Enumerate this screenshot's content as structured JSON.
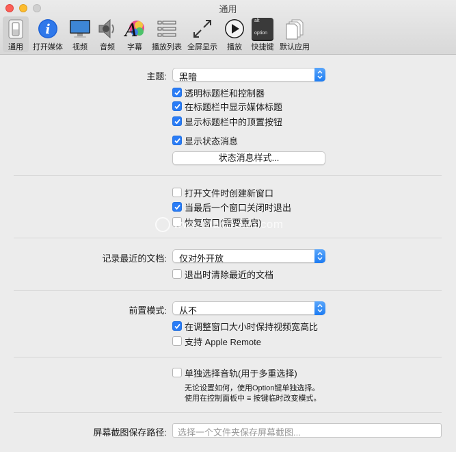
{
  "window": {
    "title": "通用"
  },
  "toolbar": {
    "items": [
      {
        "label": "通用"
      },
      {
        "label": "打开媒体"
      },
      {
        "label": "视频"
      },
      {
        "label": "音频"
      },
      {
        "label": "字幕"
      },
      {
        "label": "播放列表"
      },
      {
        "label": "全屏显示"
      },
      {
        "label": "播放"
      },
      {
        "label": "快捷键"
      },
      {
        "label": "默认应用"
      }
    ],
    "shortcut_keys": {
      "top": "alt",
      "bottom": "option"
    }
  },
  "theme": {
    "label": "主题:",
    "selected": "黑暗",
    "options": [
      {
        "label": "透明标题栏和控制器",
        "checked": true
      },
      {
        "label": "在标题栏中显示媒体标题",
        "checked": true
      },
      {
        "label": "显示标题栏中的顶置按钮",
        "checked": true
      },
      {
        "label": "显示状态消息",
        "checked": true
      }
    ],
    "status_style_button": "状态消息样式..."
  },
  "window_options": [
    {
      "label": "打开文件时创建新窗口",
      "checked": false
    },
    {
      "label": "当最后一个窗口关闭时退出",
      "checked": true
    },
    {
      "label": "恢复窗口(需要重启)",
      "checked": false
    }
  ],
  "recent": {
    "label": "记录最近的文档:",
    "selected": "仅对外开放",
    "clear_on_quit": {
      "label": "退出时清除最近的文档",
      "checked": false
    }
  },
  "front": {
    "label": "前置模式:",
    "selected": "从不",
    "options": [
      {
        "label": "在调整窗口大小时保持视频宽高比",
        "checked": true
      },
      {
        "label": "支持 Apple Remote",
        "checked": false
      }
    ]
  },
  "audio_track": {
    "label": "单独选择音轨(用于多重选择)",
    "checked": false,
    "note_1": "无论设置如何，使用Option键单独选择。",
    "note_2": "使用在控制面板中 ≡ 按键临时改变模式。"
  },
  "screenshot": {
    "label": "屏幕截图保存路径:",
    "placeholder": "选择一个文件夹保存屏幕截图..."
  },
  "watermark": {
    "text": "www.MacDown.com"
  },
  "colors": {
    "accent": "#2a7cf6",
    "window_bg": "#ececec"
  }
}
